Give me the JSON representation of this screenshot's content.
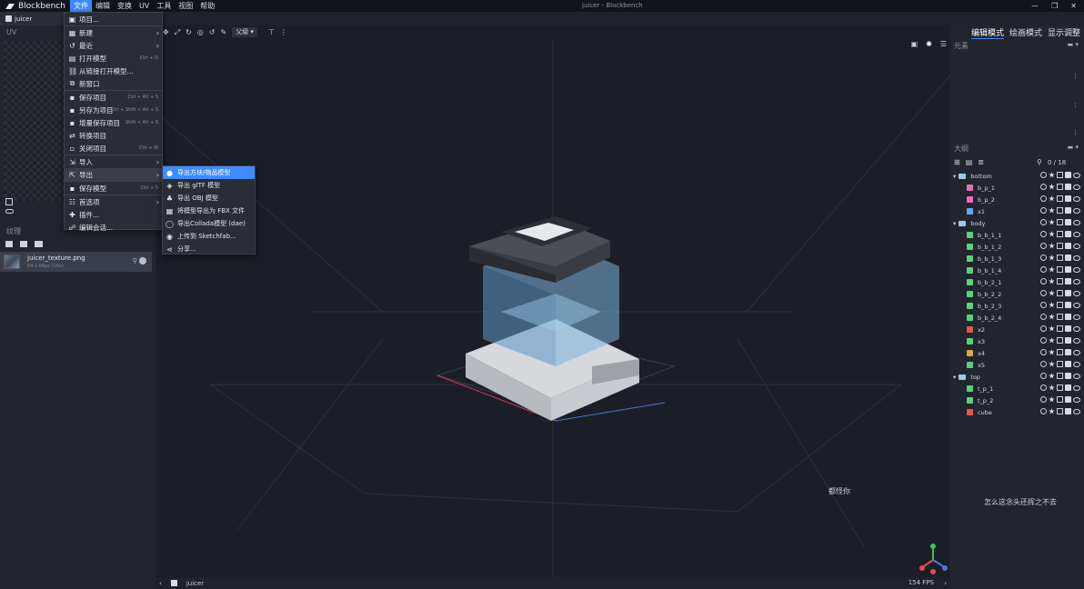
{
  "app": {
    "name": "Blockbench",
    "window_title": "juicer - Blockbench"
  },
  "menubar": [
    "文件",
    "编辑",
    "变换",
    "UV",
    "工具",
    "视图",
    "帮助"
  ],
  "window_controls": [
    "—",
    "❐",
    "✕"
  ],
  "tab": {
    "label": "juicer"
  },
  "file_menu": [
    {
      "label": "项目...",
      "icon": "project-icon",
      "shortcut": "",
      "arrow": false
    },
    {
      "label": "新建",
      "icon": "new-icon",
      "shortcut": "",
      "arrow": true
    },
    {
      "label": "最近",
      "icon": "history-icon",
      "shortcut": "",
      "arrow": true
    },
    {
      "label": "打开模型",
      "icon": "open-icon",
      "shortcut": "Ctrl + O",
      "arrow": false
    },
    {
      "label": "从链接打开模型...",
      "icon": "link-icon",
      "shortcut": "",
      "arrow": false
    },
    {
      "label": "新窗口",
      "icon": "new-window-icon",
      "shortcut": "",
      "arrow": false
    },
    {
      "label": "保存项目",
      "icon": "save-icon",
      "shortcut": "Ctrl + Alt + S",
      "arrow": false
    },
    {
      "label": "另存为项目",
      "icon": "save-as-icon",
      "shortcut": "Ctrl + Shift + Alt + S",
      "arrow": false
    },
    {
      "label": "增量保存项目",
      "icon": "save-increment-icon",
      "shortcut": "Shift + Alt + S",
      "arrow": false
    },
    {
      "label": "转换项目",
      "icon": "convert-icon",
      "shortcut": "",
      "arrow": false
    },
    {
      "label": "关闭项目",
      "icon": "close-project-icon",
      "shortcut": "Ctrl + W",
      "arrow": false
    },
    {
      "label": "导入",
      "icon": "import-icon",
      "shortcut": "",
      "arrow": true
    },
    {
      "label": "导出",
      "icon": "export-icon",
      "shortcut": "",
      "arrow": true
    },
    {
      "label": "保存模型",
      "icon": "save-model-icon",
      "shortcut": "Ctrl + S",
      "arrow": false
    },
    {
      "label": "首选项",
      "icon": "settings-icon",
      "shortcut": "",
      "arrow": true
    },
    {
      "label": "插件...",
      "icon": "plugin-icon",
      "shortcut": "",
      "arrow": false
    },
    {
      "label": "编辑会话...",
      "icon": "session-icon",
      "shortcut": "",
      "arrow": false
    }
  ],
  "export_submenu": [
    {
      "label": "导出方块/物品模型",
      "icon": "block-model-icon",
      "active": true
    },
    {
      "label": "导出 glTF 模型",
      "icon": "gltf-icon",
      "active": false
    },
    {
      "label": "导出 OBJ 模型",
      "icon": "obj-icon",
      "active": false
    },
    {
      "label": "将模型导出为 FBX 文件",
      "icon": "fbx-icon",
      "active": false
    },
    {
      "label": "导出Collada模型 (dae)",
      "icon": "collada-icon",
      "active": false
    },
    {
      "label": "上传到 Sketchfab...",
      "icon": "sketchfab-icon",
      "active": false
    },
    {
      "label": "分享...",
      "icon": "share-icon",
      "active": false
    }
  ],
  "uv_panel": {
    "title": "UV"
  },
  "textures": {
    "title": "纹理",
    "items": [
      {
        "name": "juicer_texture.png",
        "size": "64 x 64px (16x)"
      }
    ]
  },
  "toolbar": {
    "pivot_select": "父级"
  },
  "modes": [
    "编辑模式",
    "绘画模式",
    "显示调整"
  ],
  "elements_title": "元素",
  "outliner": {
    "title": "大纲",
    "count": "0 / 18",
    "rows": [
      {
        "name": "bottom",
        "type": "group",
        "indent": 0,
        "color": ""
      },
      {
        "name": "b_p_1",
        "type": "cube",
        "indent": 1,
        "color": "#e86fb5"
      },
      {
        "name": "b_p_2",
        "type": "cube",
        "indent": 1,
        "color": "#e86fb5"
      },
      {
        "name": "x1",
        "type": "cube",
        "indent": 1,
        "color": "#6aa8f0"
      },
      {
        "name": "body",
        "type": "group",
        "indent": 0,
        "color": ""
      },
      {
        "name": "b_b_1_1",
        "type": "cube",
        "indent": 1,
        "color": "#59d27a"
      },
      {
        "name": "b_b_1_2",
        "type": "cube",
        "indent": 1,
        "color": "#59d27a"
      },
      {
        "name": "b_b_1_3",
        "type": "cube",
        "indent": 1,
        "color": "#59d27a"
      },
      {
        "name": "b_b_1_4",
        "type": "cube",
        "indent": 1,
        "color": "#59d27a"
      },
      {
        "name": "b_b_2_1",
        "type": "cube",
        "indent": 1,
        "color": "#59d27a"
      },
      {
        "name": "b_b_2_2",
        "type": "cube",
        "indent": 1,
        "color": "#59d27a"
      },
      {
        "name": "b_b_2_3",
        "type": "cube",
        "indent": 1,
        "color": "#59d27a"
      },
      {
        "name": "b_b_2_4",
        "type": "cube",
        "indent": 1,
        "color": "#59d27a"
      },
      {
        "name": "x2",
        "type": "cube",
        "indent": 1,
        "color": "#e2584f"
      },
      {
        "name": "x3",
        "type": "cube",
        "indent": 1,
        "color": "#59d27a"
      },
      {
        "name": "x4",
        "type": "cube",
        "indent": 1,
        "color": "#e0a24a"
      },
      {
        "name": "x5",
        "type": "cube",
        "indent": 1,
        "color": "#59d27a"
      },
      {
        "name": "top",
        "type": "group",
        "indent": 0,
        "color": ""
      },
      {
        "name": "t_p_1",
        "type": "cube",
        "indent": 1,
        "color": "#59d27a"
      },
      {
        "name": "t_p_2",
        "type": "cube",
        "indent": 1,
        "color": "#59d27a"
      },
      {
        "name": "cube",
        "type": "cube",
        "indent": 1,
        "color": "#e2584f"
      }
    ]
  },
  "viewport": {
    "annotation": "都怪你"
  },
  "right_note": "怎么这念头还挥之不去",
  "status": {
    "model": "juicer",
    "fps": "154 FPS"
  },
  "colors": {
    "accent": "#3d8bff",
    "arrow": "#e0342f"
  }
}
